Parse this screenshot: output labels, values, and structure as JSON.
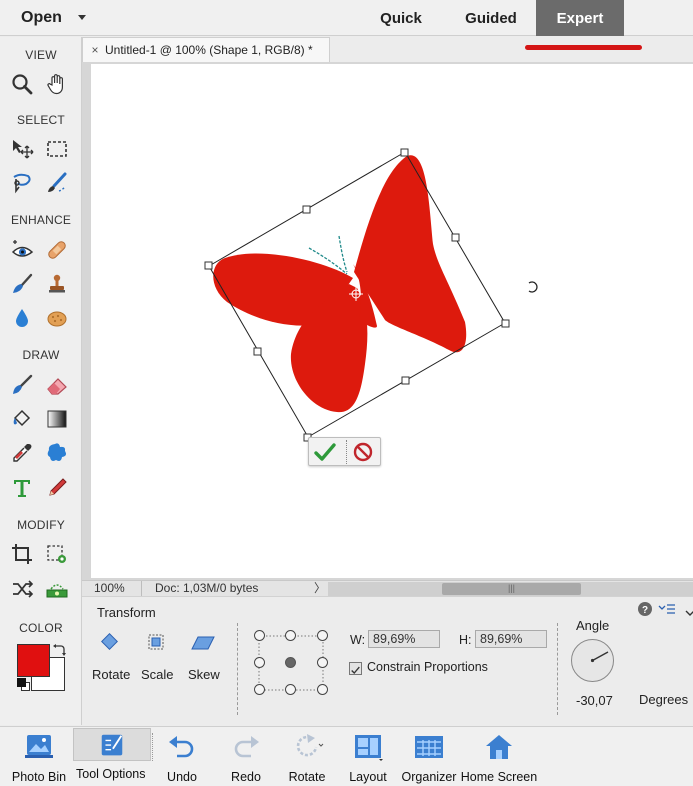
{
  "topbar": {
    "open_label": "Open",
    "tabs": [
      {
        "label": "Quick"
      },
      {
        "label": "Guided"
      },
      {
        "label": "Expert"
      }
    ],
    "accent_color": "#d41515"
  },
  "toolbox": {
    "sections": {
      "view": "VIEW",
      "select": "SELECT",
      "enhance": "ENHANCE",
      "draw": "DRAW",
      "modify": "MODIFY",
      "color": "COLOR"
    },
    "foreground_color": "#e01010",
    "background_color": "#ffffff"
  },
  "document": {
    "tab_close": "×",
    "tab_title": "Untitled-1 @ 100% (Shape 1, RGB/8) *",
    "shape_color": "#dd1a0d"
  },
  "status": {
    "zoom": "100%",
    "doc_info": "Doc: 1,03M/0 bytes",
    "arrow": "〉"
  },
  "transform_panel": {
    "title": "Transform",
    "modes": [
      {
        "label": "Rotate"
      },
      {
        "label": "Scale"
      },
      {
        "label": "Skew"
      }
    ],
    "width_label": "W:",
    "width_value": "89,69%",
    "height_label": "H:",
    "height_value": "89,69%",
    "constrain_label": "Constrain Proportions",
    "constrain_checked": true,
    "angle_label": "Angle",
    "angle_value": "-30,07",
    "degrees_label": "Degrees"
  },
  "bottombar": {
    "items": [
      {
        "label": "Photo Bin"
      },
      {
        "label": "Tool Options"
      },
      {
        "label": "Undo"
      },
      {
        "label": "Redo"
      },
      {
        "label": "Rotate"
      },
      {
        "label": "Layout"
      },
      {
        "label": "Organizer"
      },
      {
        "label": "Home Screen"
      }
    ]
  }
}
